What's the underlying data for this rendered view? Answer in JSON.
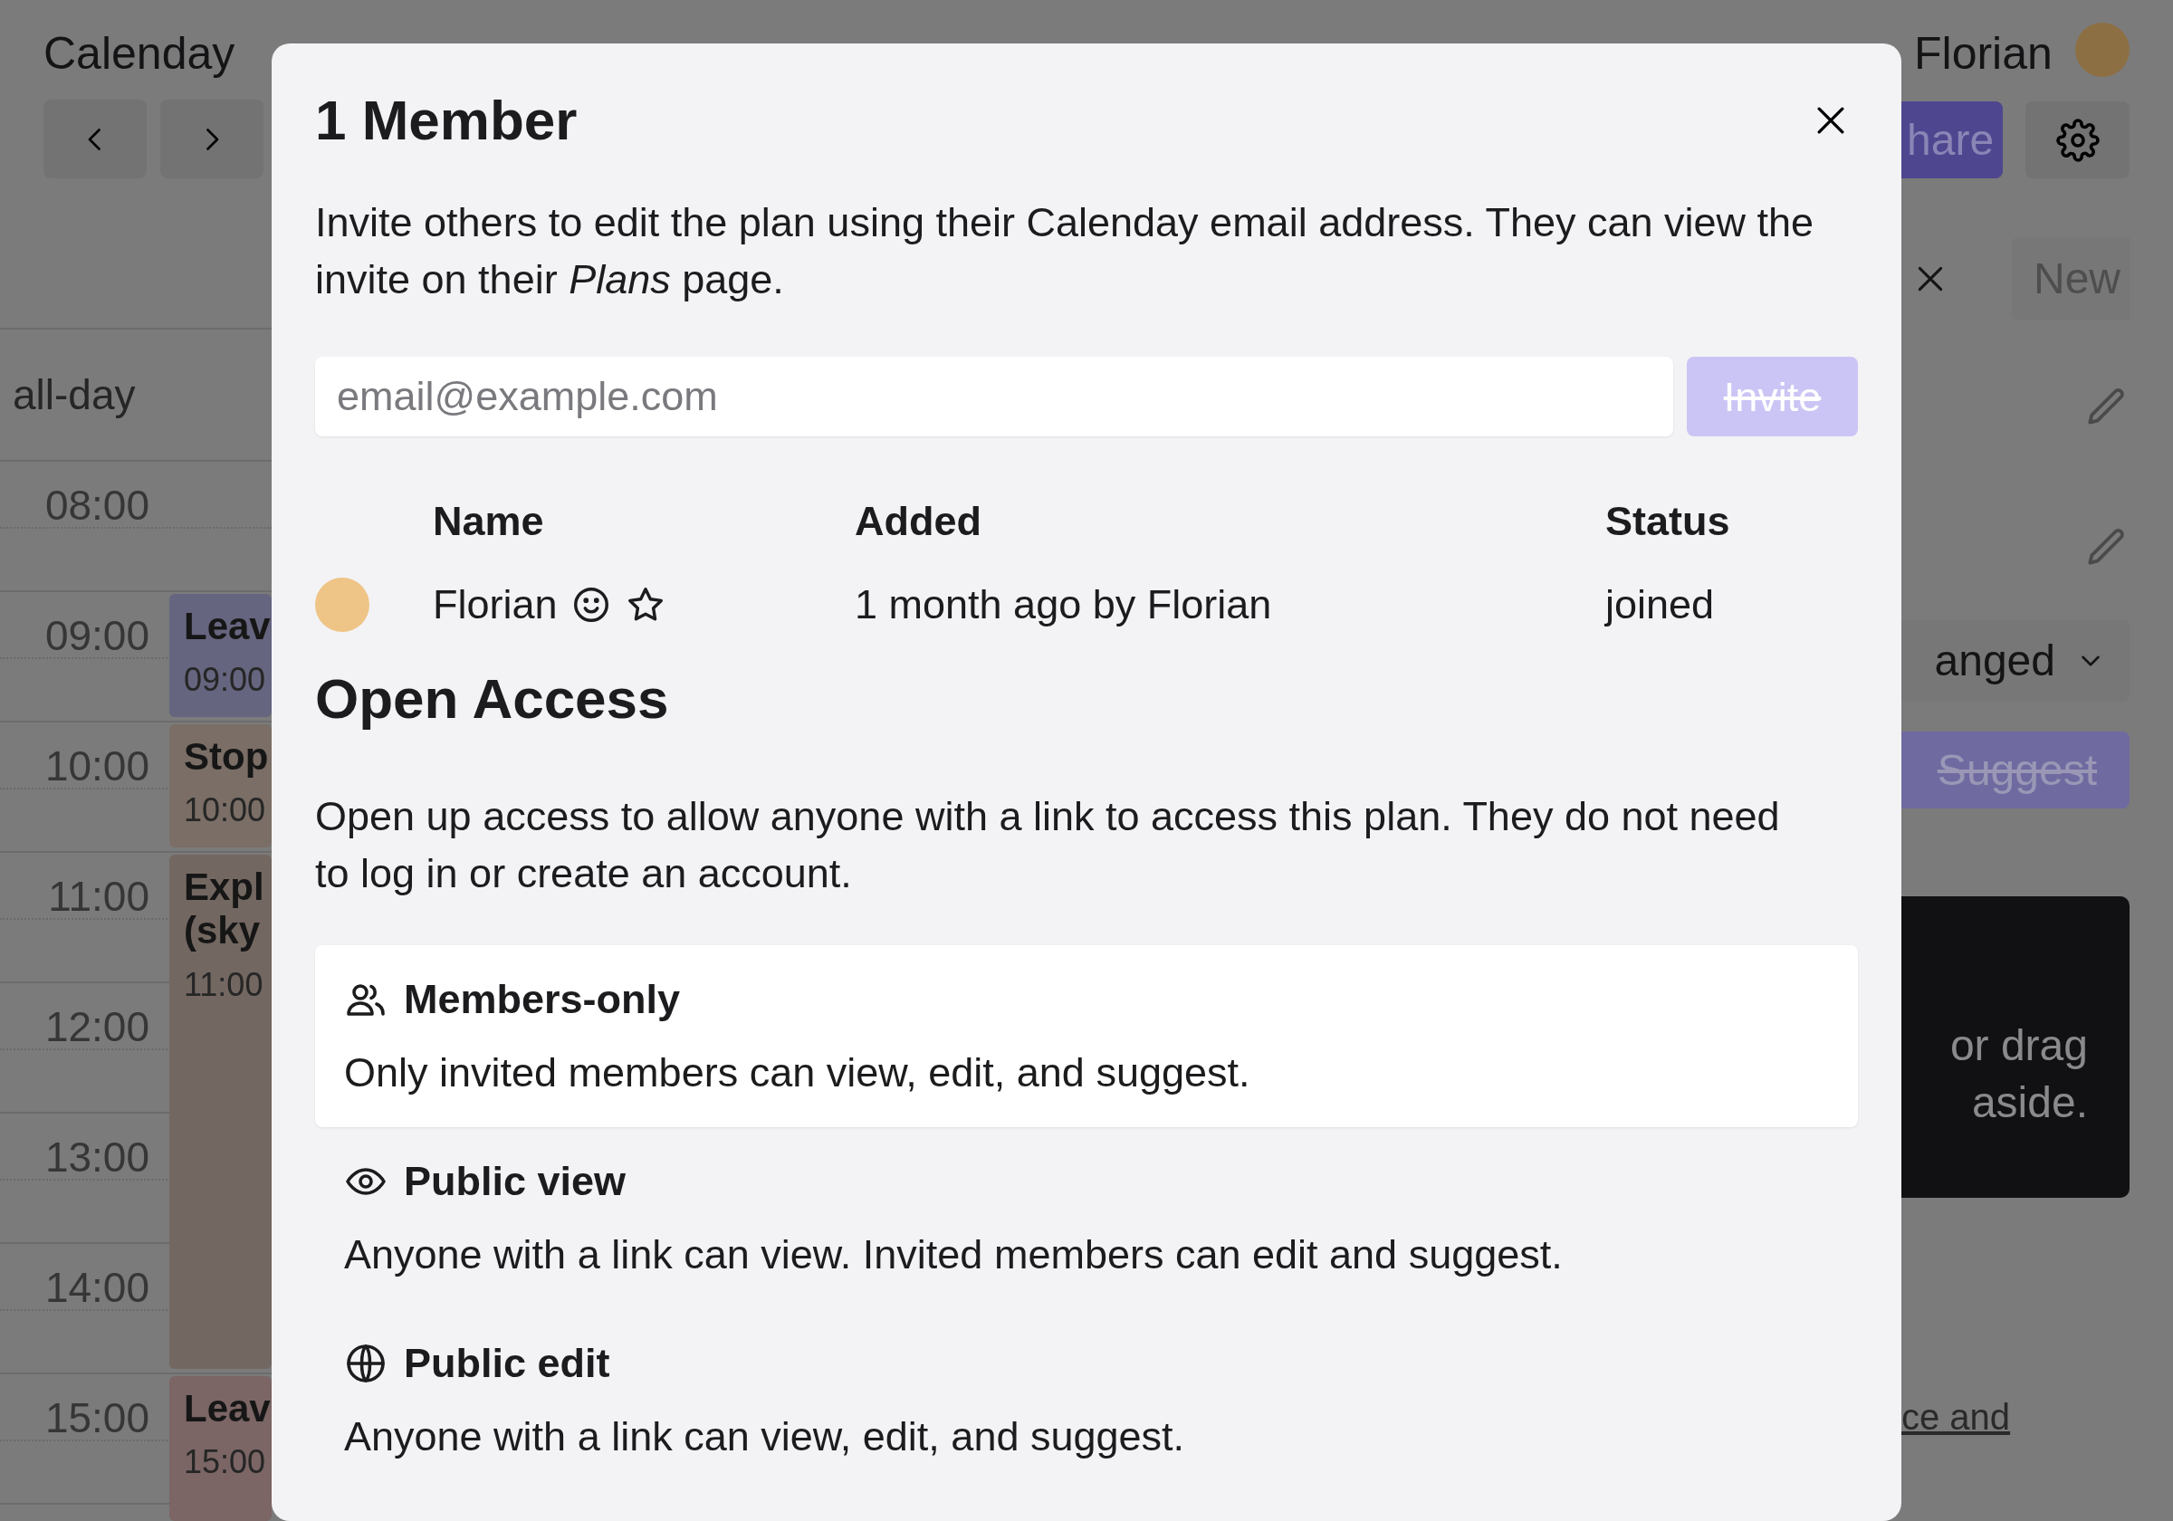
{
  "app_title": "Calenday",
  "user": {
    "name": "Florian"
  },
  "toolbar": {
    "share_button": "hare",
    "new_button": "New",
    "filter_dropdown": "anged",
    "suggest_button": {
      "label": "Suggest",
      "disabled": true
    },
    "hint_lines": [
      "or drag",
      "aside."
    ],
    "link": "ce and"
  },
  "calendar": {
    "all_day_label": "all-day",
    "hours": [
      "08:00",
      "09:00",
      "10:00",
      "11:00",
      "12:00",
      "13:00",
      "14:00",
      "15:00"
    ],
    "events": [
      {
        "title_lines": [
          "Leav"
        ],
        "time": "09:00",
        "color": "#65657f"
      },
      {
        "title_lines": [
          "Stop"
        ],
        "time": "10:00",
        "color": "#7a6e66"
      },
      {
        "title_lines": [
          "Expl",
          "(sky"
        ],
        "time": "11:00",
        "color": "#736761"
      },
      {
        "title_lines": [
          "Leav"
        ],
        "time": "15:00",
        "color": "#7b6565"
      }
    ]
  },
  "dialog": {
    "title": "1 Member",
    "intro": "Invite others to edit the plan using their Calenday email address. They can view the invite on their *Plans* page.",
    "email_field": {
      "placeholder": "email@example.com"
    },
    "invite_button": {
      "label": "Invite",
      "disabled": true
    },
    "members_table": {
      "columns": [
        "Name",
        "Added",
        "Status"
      ],
      "rows": [
        {
          "name": "Florian",
          "added": "1 month ago by Florian",
          "status": "joined"
        }
      ]
    },
    "open_access": {
      "heading": "Open Access",
      "description": "Open up access to allow anyone with a link to access this plan. They do not need to log in or create an account.",
      "options": [
        {
          "kind": "members",
          "title": "Members-only",
          "description": "Only invited members can view, edit, and suggest.",
          "selected": true
        },
        {
          "kind": "view",
          "title": "Public view",
          "description": "Anyone with a link can view. Invited members can edit and suggest.",
          "selected": false
        },
        {
          "kind": "edit",
          "title": "Public edit",
          "description": "Anyone with a link can view, edit, and suggest.",
          "selected": false
        }
      ]
    }
  }
}
